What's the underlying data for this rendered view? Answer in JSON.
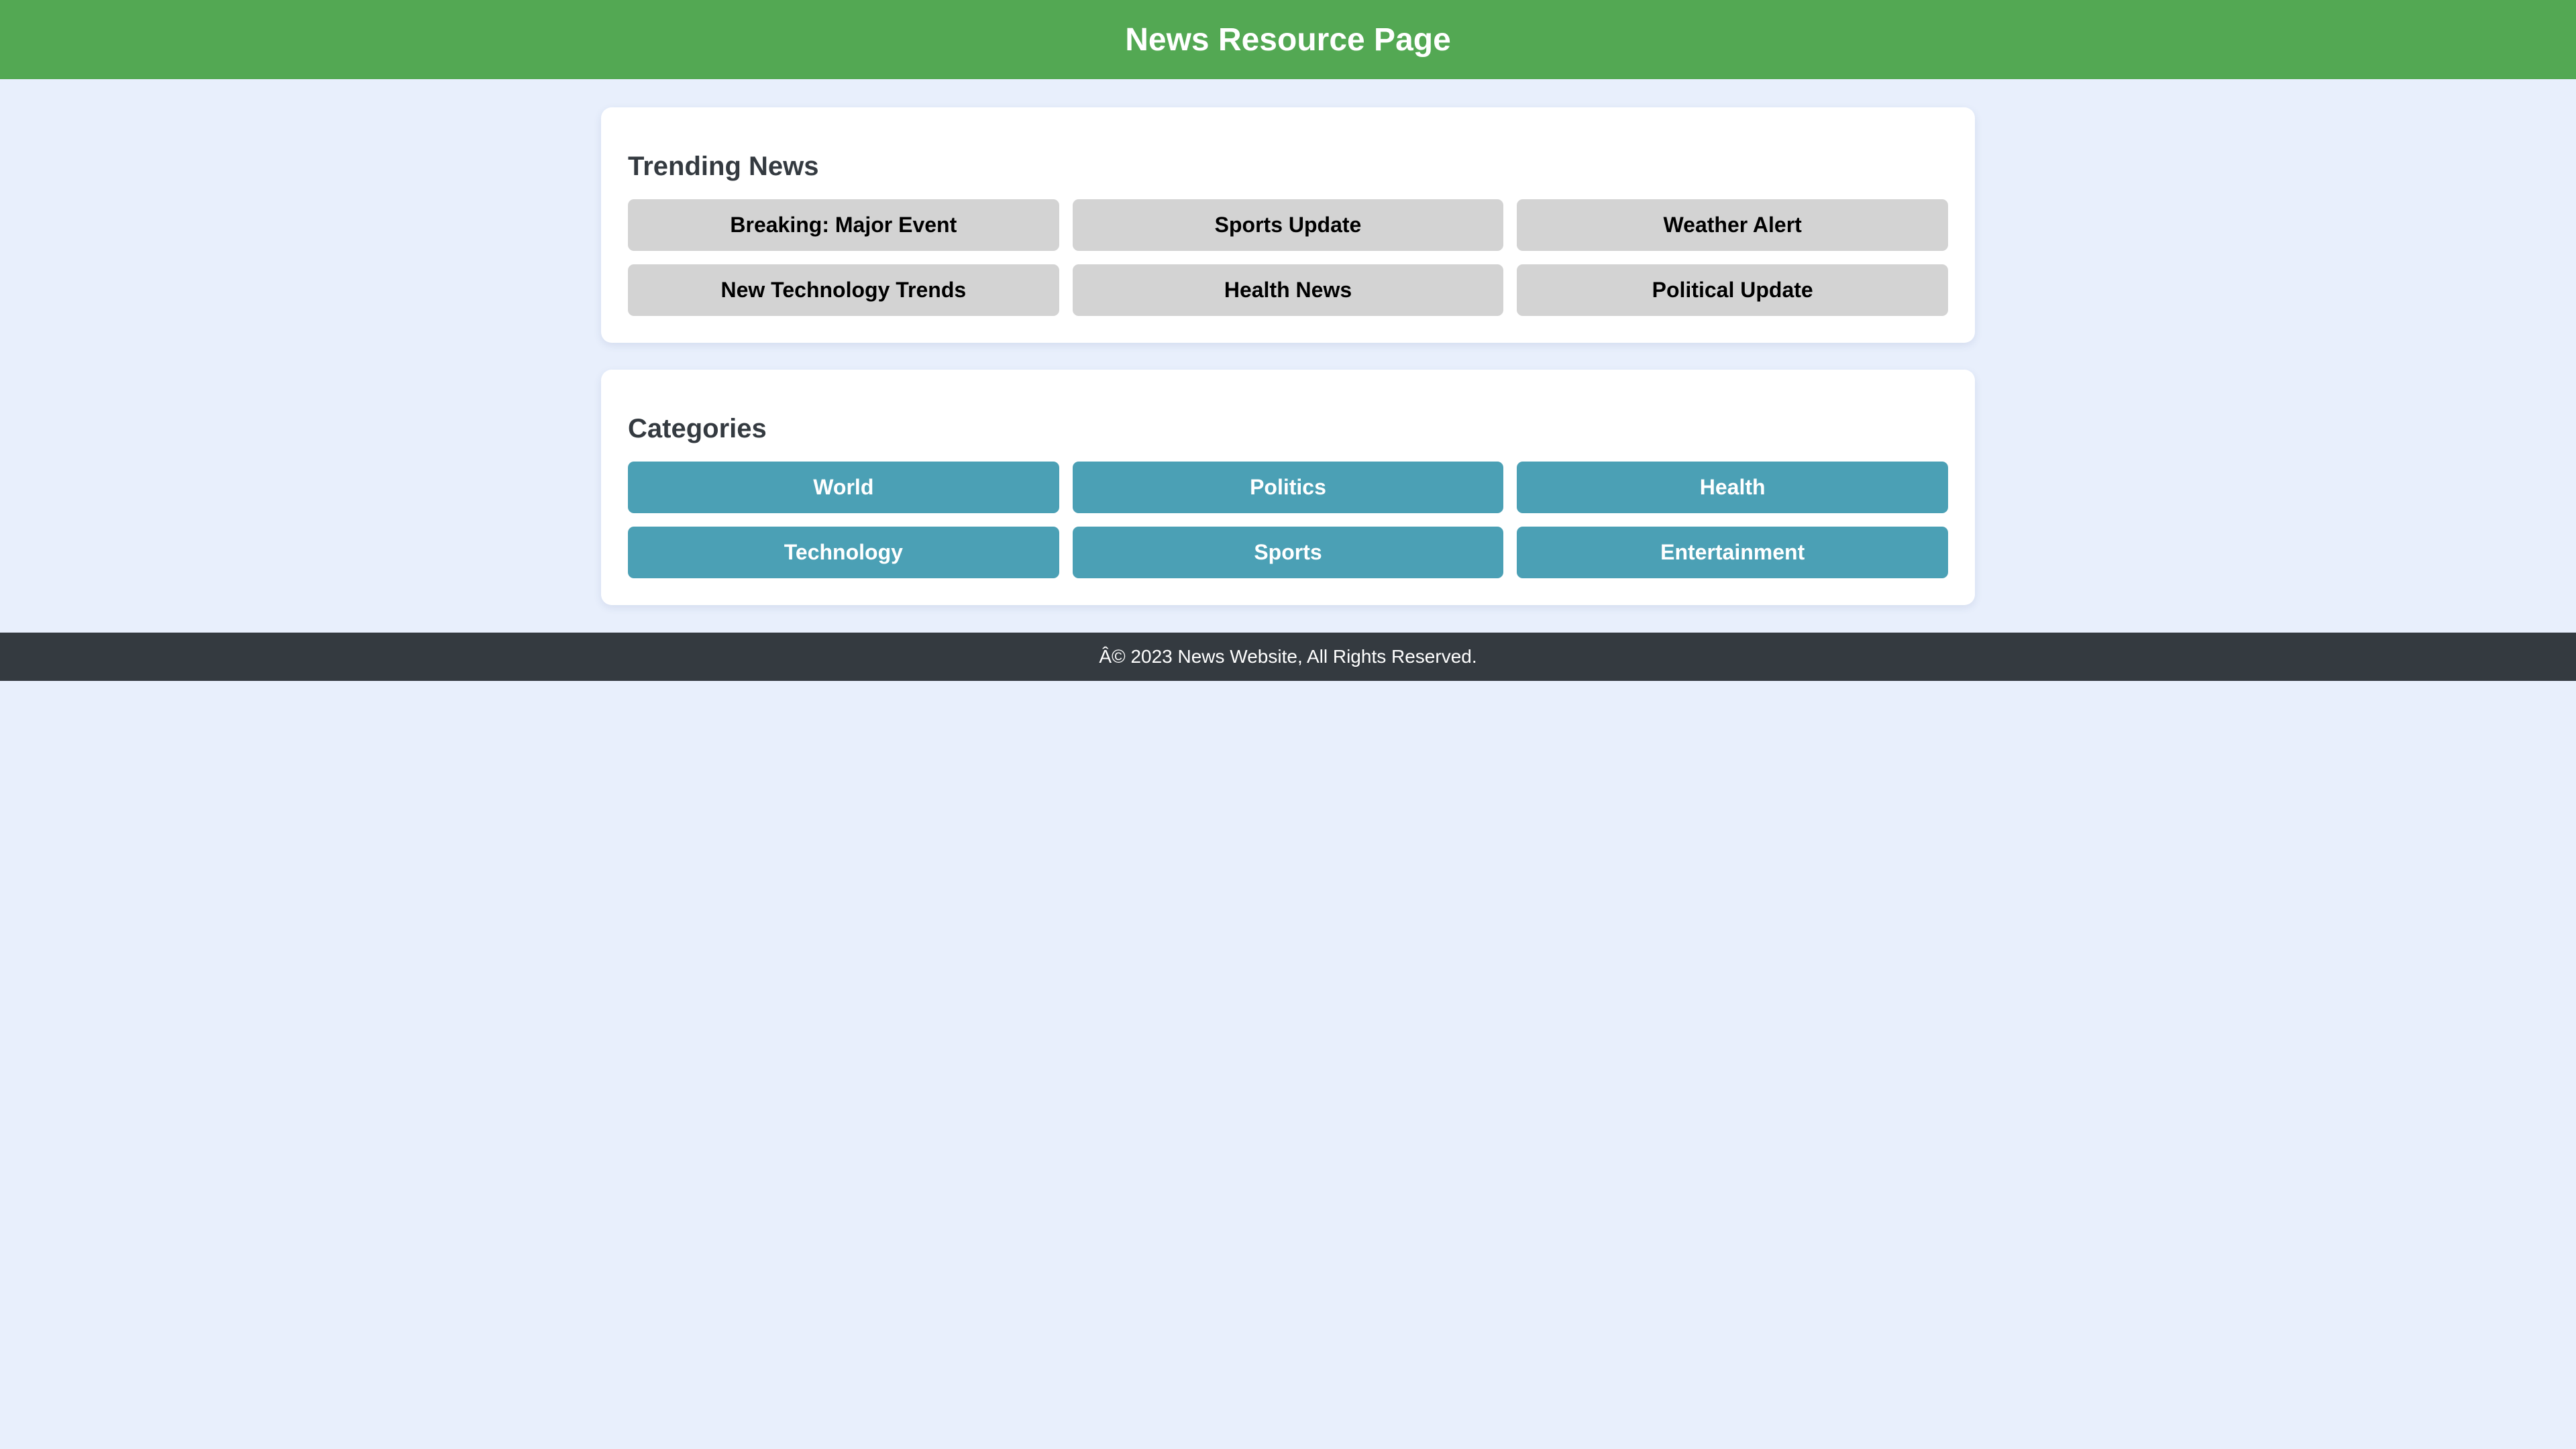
{
  "header": {
    "title": "News Resource Page"
  },
  "trending": {
    "heading": "Trending News",
    "items": [
      {
        "label": "Breaking: Major Event"
      },
      {
        "label": "Sports Update"
      },
      {
        "label": "Weather Alert"
      },
      {
        "label": "New Technology Trends"
      },
      {
        "label": "Health News"
      },
      {
        "label": "Political Update"
      }
    ]
  },
  "categories": {
    "heading": "Categories",
    "items": [
      {
        "label": "World"
      },
      {
        "label": "Politics"
      },
      {
        "label": "Health"
      },
      {
        "label": "Technology"
      },
      {
        "label": "Sports"
      },
      {
        "label": "Entertainment"
      }
    ]
  },
  "footer": {
    "text": "Â© 2023 News Website, All Rights Reserved."
  },
  "colors": {
    "header_bg": "#53a853",
    "page_bg": "#e8effc",
    "news_button_bg": "#d3d3d3",
    "category_button_bg": "#4ba0b5",
    "footer_bg": "#343a40"
  }
}
